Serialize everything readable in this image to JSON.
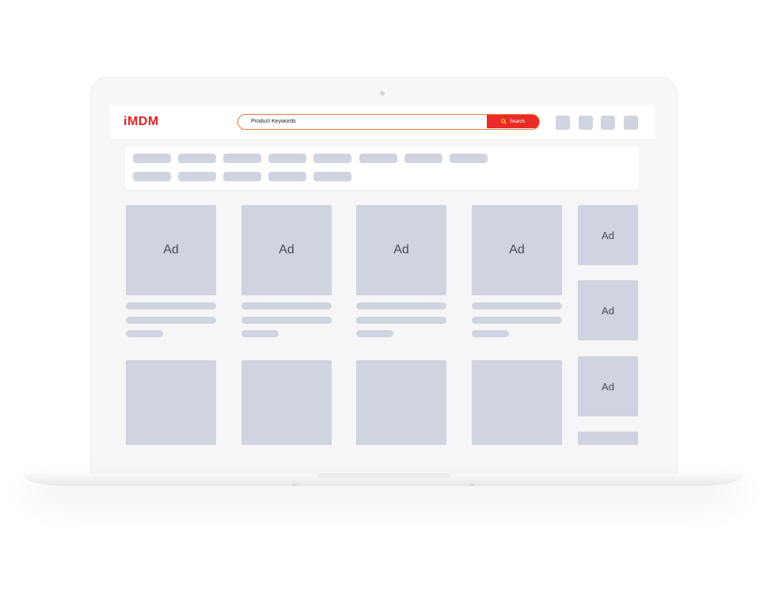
{
  "header": {
    "logo_text": "iMDM",
    "search": {
      "placeholder": "Product Keywords",
      "button_label": "Search"
    },
    "icon_count": 4
  },
  "category_pills": {
    "row1_count": 8,
    "row2_count": 5
  },
  "products": {
    "ad_label": "Ad",
    "main_grid_ads": [
      "Ad",
      "Ad",
      "Ad",
      "Ad"
    ],
    "side_ads": [
      "Ad",
      "Ad",
      "Ad"
    ]
  },
  "colors": {
    "brand_red": "#e52420",
    "search_border": "#f07a32",
    "placeholder_gray": "#d0d4e0"
  }
}
